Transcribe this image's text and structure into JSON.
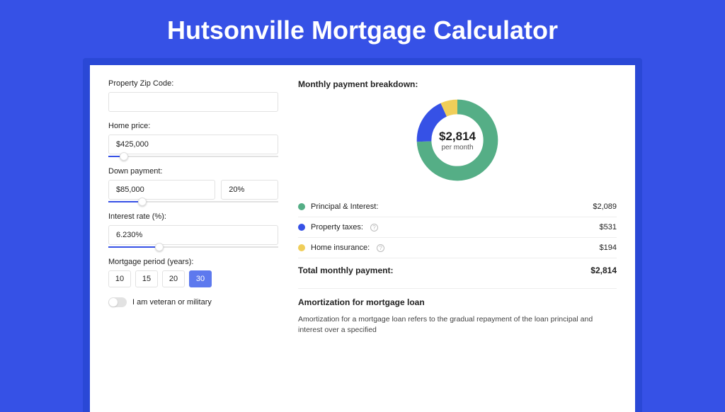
{
  "header": {
    "title": "Hutsonville Mortgage Calculator"
  },
  "form": {
    "zip": {
      "label": "Property Zip Code:",
      "value": ""
    },
    "home_price": {
      "label": "Home price:",
      "value": "$425,000",
      "slider_percent": 9
    },
    "down_payment": {
      "label": "Down payment:",
      "value": "$85,000",
      "percent": "20%",
      "slider_percent": 20
    },
    "interest_rate": {
      "label": "Interest rate (%):",
      "value": "6.230%",
      "slider_percent": 30
    },
    "period": {
      "label": "Mortgage period (years):",
      "options": [
        "10",
        "15",
        "20",
        "30"
      ],
      "selected": "30"
    },
    "veteran": {
      "label": "I am veteran or military",
      "checked": false
    }
  },
  "breakdown": {
    "title": "Monthly payment breakdown:",
    "total_value": "$2,814",
    "total_sub": "per month",
    "items": [
      {
        "name": "principal_interest",
        "label": "Principal & Interest:",
        "value": "$2,089",
        "color": "#55AE86",
        "help": false
      },
      {
        "name": "property_taxes",
        "label": "Property taxes:",
        "value": "$531",
        "color": "#3651E6",
        "help": true
      },
      {
        "name": "home_insurance",
        "label": "Home insurance:",
        "value": "$194",
        "color": "#F0CE59",
        "help": true
      }
    ],
    "total_label": "Total monthly payment:",
    "total_amount": "$2,814"
  },
  "amortization": {
    "title": "Amortization for mortgage loan",
    "body": "Amortization for a mortgage loan refers to the gradual repayment of the loan principal and interest over a specified"
  },
  "chart_data": {
    "type": "pie",
    "title": "Monthly payment breakdown",
    "series": [
      {
        "name": "Principal & Interest",
        "value": 2089,
        "color": "#55AE86"
      },
      {
        "name": "Property taxes",
        "value": 531,
        "color": "#3651E6"
      },
      {
        "name": "Home insurance",
        "value": 194,
        "color": "#F0CE59"
      }
    ],
    "total": 2814,
    "center_label": "$2,814 per month"
  }
}
